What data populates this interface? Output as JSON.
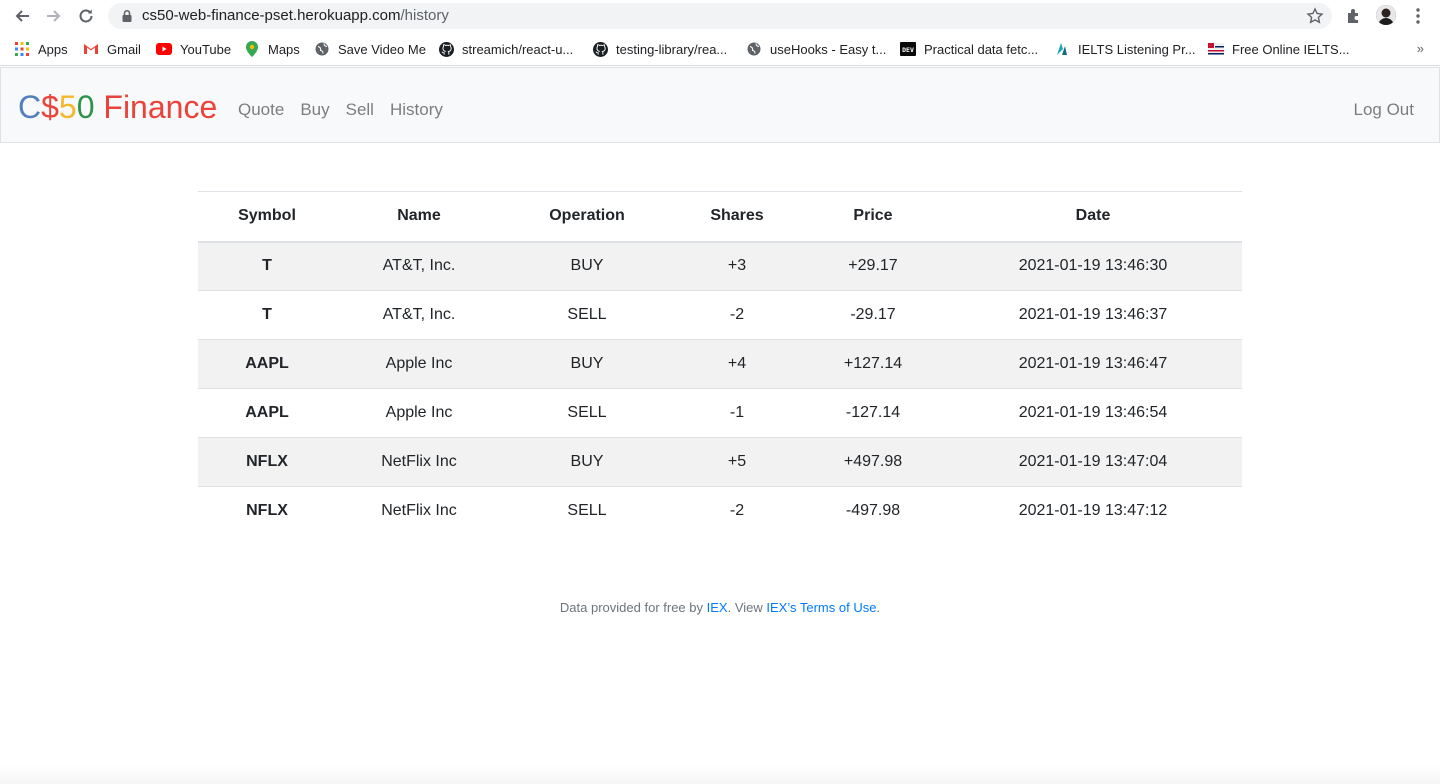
{
  "browser": {
    "url_host": "cs50-web-finance-pset.herokuapp.com",
    "url_path": "/history",
    "bookmarks": [
      {
        "label": "Apps",
        "icon": "apps-grid-icon"
      },
      {
        "label": "Gmail",
        "icon": "gmail-icon"
      },
      {
        "label": "YouTube",
        "icon": "youtube-icon"
      },
      {
        "label": "Maps",
        "icon": "maps-pin-icon"
      },
      {
        "label": "Save Video Me",
        "icon": "globe-icon"
      },
      {
        "label": "streamich/react-u...",
        "icon": "github-icon"
      },
      {
        "label": "testing-library/rea...",
        "icon": "github-icon"
      },
      {
        "label": "useHooks - Easy t...",
        "icon": "globe-icon"
      },
      {
        "label": "Practical data fetc...",
        "icon": "dev-icon"
      },
      {
        "label": "IELTS Listening Pr...",
        "icon": "ielts-icon"
      },
      {
        "label": "Free Online IELTS...",
        "icon": "flag-icon"
      }
    ],
    "more": "»",
    "dev_badge": "DEV"
  },
  "app": {
    "brand": {
      "c": "C",
      "dollar": "$",
      "five": "5",
      "zero": "0",
      "finance": " Finance"
    },
    "nav": [
      "Quote",
      "Buy",
      "Sell",
      "History"
    ],
    "logout": "Log Out"
  },
  "table": {
    "headers": [
      "Symbol",
      "Name",
      "Operation",
      "Shares",
      "Price",
      "Date"
    ],
    "rows": [
      [
        "T",
        "AT&T, Inc.",
        "BUY",
        "+3",
        "+29.17",
        "2021-01-19 13:46:30"
      ],
      [
        "T",
        "AT&T, Inc.",
        "SELL",
        "-2",
        "-29.17",
        "2021-01-19 13:46:37"
      ],
      [
        "AAPL",
        "Apple Inc",
        "BUY",
        "+4",
        "+127.14",
        "2021-01-19 13:46:47"
      ],
      [
        "AAPL",
        "Apple Inc",
        "SELL",
        "-1",
        "-127.14",
        "2021-01-19 13:46:54"
      ],
      [
        "NFLX",
        "NetFlix Inc",
        "BUY",
        "+5",
        "+497.98",
        "2021-01-19 13:47:04"
      ],
      [
        "NFLX",
        "NetFlix Inc",
        "SELL",
        "-2",
        "-497.98",
        "2021-01-19 13:47:12"
      ]
    ]
  },
  "footer": {
    "prefix": "Data provided for free by ",
    "iex": "IEX",
    "middle": ". View ",
    "terms": "IEX’s Terms of Use",
    "suffix": "."
  },
  "colors": {
    "brand_blue": "#537fbe",
    "brand_red": "#ea433b",
    "brand_yellow": "#f5b82e",
    "brand_green": "#2e944b",
    "link": "#007bff",
    "stripe": "#f2f2f2"
  }
}
